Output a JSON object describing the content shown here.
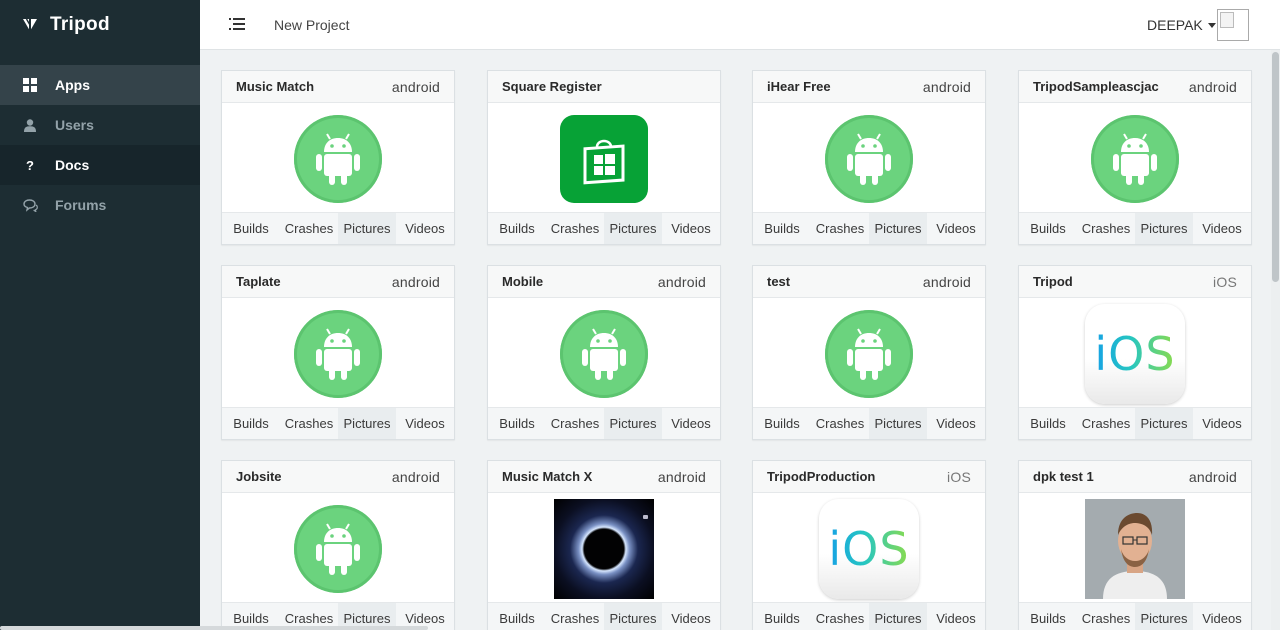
{
  "sidebar": {
    "brand": "Tripod",
    "items": [
      {
        "label": "Apps",
        "icon": "grid-icon"
      },
      {
        "label": "Users",
        "icon": "user-icon"
      },
      {
        "label": "Docs",
        "icon": "question-icon"
      },
      {
        "label": "Forums",
        "icon": "chat-icon"
      }
    ]
  },
  "topbar": {
    "project": "New Project",
    "user": "DEEPAK"
  },
  "colors": {
    "sidebar_bg": "#1d2d33",
    "android_green": "#6bd37e",
    "store_green": "#07a236"
  },
  "footer_links": [
    "Builds",
    "Crashes",
    "Pictures",
    "Videos"
  ],
  "apps": [
    {
      "name": "Music Match",
      "platform": "android",
      "image": "android-icon"
    },
    {
      "name": "Square Register",
      "platform": "",
      "image": "store-icon"
    },
    {
      "name": "iHear Free",
      "platform": "android",
      "image": "android-icon"
    },
    {
      "name": "TripodSampleascjac",
      "platform": "android",
      "image": "android-icon"
    },
    {
      "name": "Taplate",
      "platform": "android",
      "image": "android-icon"
    },
    {
      "name": "Mobile",
      "platform": "android",
      "image": "android-icon"
    },
    {
      "name": "test",
      "platform": "android",
      "image": "android-icon"
    },
    {
      "name": "Tripod",
      "platform": "iOS",
      "image": "ios-icon"
    },
    {
      "name": "Jobsite",
      "platform": "android",
      "image": "android-icon"
    },
    {
      "name": "Music Match X",
      "platform": "android",
      "image": "eclipse-photo"
    },
    {
      "name": "TripodProduction",
      "platform": "iOS",
      "image": "ios-icon"
    },
    {
      "name": "dpk test 1",
      "platform": "android",
      "image": "person-photo"
    }
  ],
  "ios_logo_text": "iOS"
}
